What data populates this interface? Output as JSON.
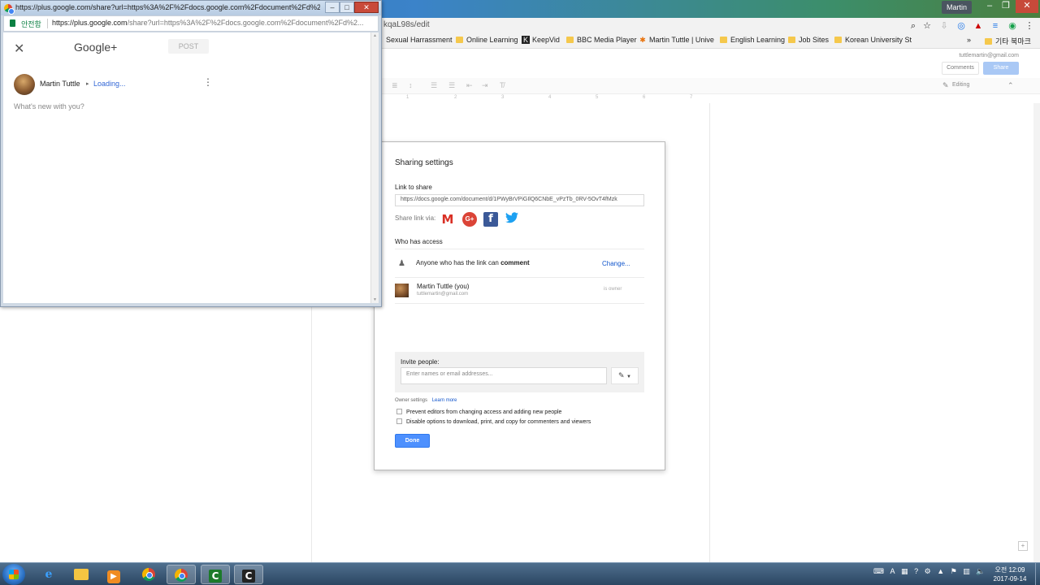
{
  "main_browser": {
    "profile_name": "Martin",
    "url_fragment": "kqaL98s/edit",
    "bookmarks": [
      {
        "label": "Sexual Harrassment",
        "kind": "page"
      },
      {
        "label": "Online Learning",
        "kind": "folder"
      },
      {
        "label": "KeepVid",
        "kind": "K"
      },
      {
        "label": "BBC Media Player",
        "kind": "folder"
      },
      {
        "label": "Martin Tuttle | Unive",
        "kind": "star"
      },
      {
        "label": "English Learning",
        "kind": "folder"
      },
      {
        "label": "Job Sites",
        "kind": "folder"
      },
      {
        "label": "Korean University St",
        "kind": "folder"
      },
      {
        "label": "기타 북마크",
        "kind": "folder"
      }
    ],
    "bookmarks_overflow": "»"
  },
  "docs": {
    "user_email": "tuttlemartin@gmail.com",
    "comments_label": "Comments",
    "share_label": "Share",
    "editing_label": "Editing",
    "ruler_marks": [
      "1",
      "2",
      "3",
      "4",
      "5",
      "6",
      "7"
    ]
  },
  "share_dialog": {
    "title": "Sharing settings",
    "link_label": "Link to share",
    "link_value": "https://docs.google.com/document/d/1PWyBrVPiGIlQ6CNbE_vPzTb_0RV-5OvT4fMzk",
    "share_via_label": "Share link via:",
    "services": [
      {
        "name": "Gmail",
        "glyph": "M",
        "icon": "gmail-icon"
      },
      {
        "name": "Google+",
        "glyph": "G+",
        "icon": "google-plus-icon"
      },
      {
        "name": "Facebook",
        "glyph": "f",
        "icon": "facebook-icon"
      },
      {
        "name": "Twitter",
        "glyph": "🐦",
        "icon": "twitter-icon"
      }
    ],
    "who_has_access_label": "Who has access",
    "access_text_prefix": "Anyone who has the link can ",
    "access_level": "comment",
    "change_link": "Change...",
    "owner_name": "Martin Tuttle (you)",
    "owner_email": "tuttlemartin@gmail.com",
    "owner_role": "is owner",
    "invite_label": "Invite people:",
    "invite_placeholder": "Enter names or email addresses...",
    "owner_settings_label": "Owner settings",
    "learn_more": "Learn more",
    "option_prevent_editors": "Prevent editors from changing access and adding new people",
    "option_disable_download": "Disable options to download, print, and copy for commenters and viewers",
    "done_label": "Done"
  },
  "gplus_popup": {
    "window_title": "https://plus.google.com/share?url=https%3A%2F%2Fdocs.google.com%2Fdocument%2Fd%2F1PWyBrV...",
    "secure_label": "안전함",
    "url_host": "https://plus.google.com",
    "url_rest": "/share?url=https%3A%2F%2Fdocs.google.com%2Fdocument%2Fd%2...",
    "logo": "Google+",
    "post_label": "POST",
    "user_name": "Martin Tuttle",
    "loading_text": "Loading...",
    "placeholder": "What's new with you?"
  },
  "taskbar": {
    "tray_lang": "A",
    "time": "오전 12:09",
    "date": "2017-09-14"
  }
}
